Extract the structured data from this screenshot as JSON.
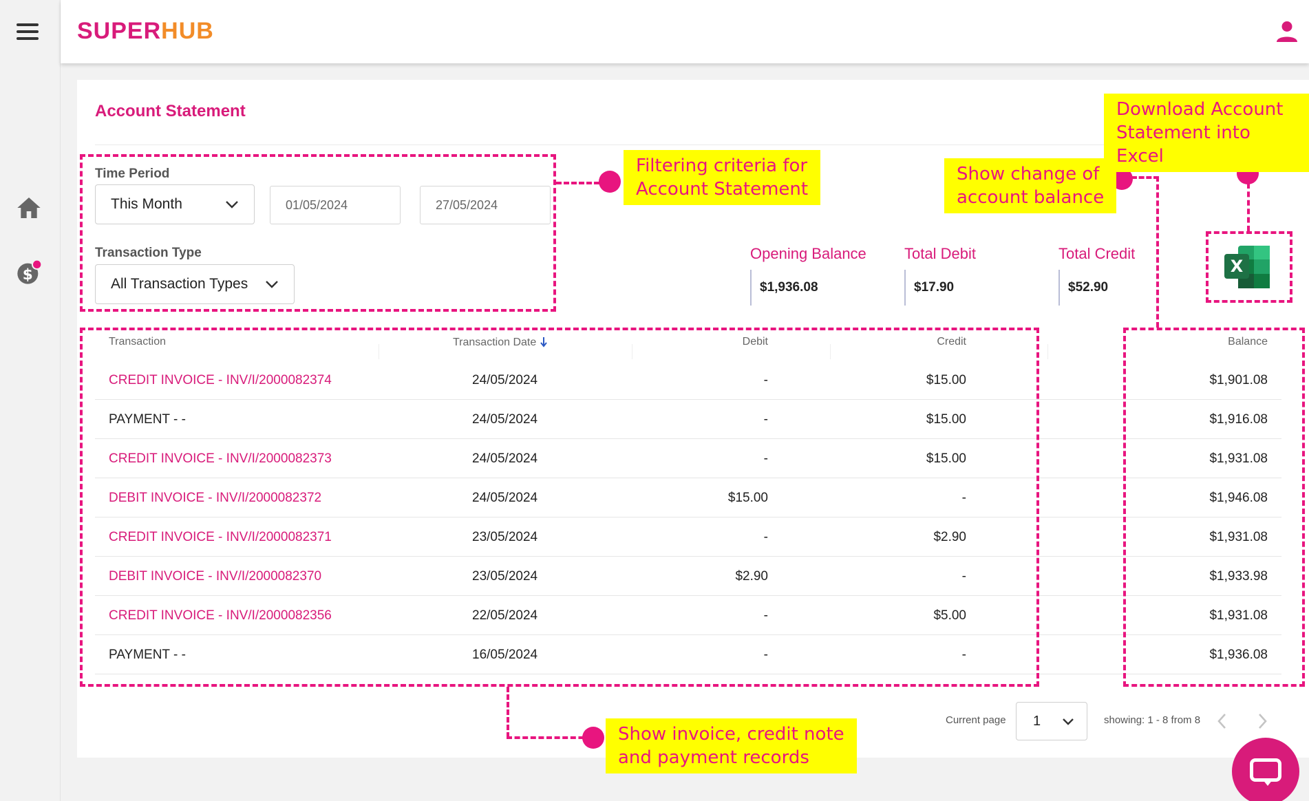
{
  "app": {
    "logo_part1": "SUPER",
    "logo_part2": "HUB"
  },
  "page": {
    "title": "Account Statement"
  },
  "filters": {
    "time_period_label": "Time Period",
    "time_period_value": "This Month",
    "start_date": "01/05/2024",
    "end_date": "27/05/2024",
    "transaction_type_label": "Transaction Type",
    "transaction_type_value": "All Transaction Types"
  },
  "summary": {
    "opening_label": "Opening Balance",
    "opening_value": "$1,936.08",
    "debit_label": "Total Debit",
    "debit_value": "$17.90",
    "credit_label": "Total Credit",
    "credit_value": "$52.90"
  },
  "table": {
    "headers": {
      "transaction": "Transaction",
      "date": "Transaction Date",
      "debit": "Debit",
      "credit": "Credit",
      "balance": "Balance"
    },
    "rows": [
      {
        "transaction": "CREDIT INVOICE - INV/I/2000082374",
        "date": "24/05/2024",
        "debit": "-",
        "credit": "$15.00",
        "balance": "$1,901.08"
      },
      {
        "transaction": "PAYMENT - -",
        "date": "24/05/2024",
        "debit": "-",
        "credit": "$15.00",
        "balance": "$1,916.08"
      },
      {
        "transaction": "CREDIT INVOICE - INV/I/2000082373",
        "date": "24/05/2024",
        "debit": "-",
        "credit": "$15.00",
        "balance": "$1,931.08"
      },
      {
        "transaction": "DEBIT INVOICE - INV/I/2000082372",
        "date": "24/05/2024",
        "debit": "$15.00",
        "credit": "-",
        "balance": "$1,946.08"
      },
      {
        "transaction": "CREDIT INVOICE - INV/I/2000082371",
        "date": "23/05/2024",
        "debit": "-",
        "credit": "$2.90",
        "balance": "$1,931.08"
      },
      {
        "transaction": "DEBIT INVOICE - INV/I/2000082370",
        "date": "23/05/2024",
        "debit": "$2.90",
        "credit": "-",
        "balance": "$1,933.98"
      },
      {
        "transaction": "CREDIT INVOICE - INV/I/2000082356",
        "date": "22/05/2024",
        "debit": "-",
        "credit": "$5.00",
        "balance": "$1,931.08"
      },
      {
        "transaction": "PAYMENT - -",
        "date": "16/05/2024",
        "debit": "-",
        "credit": "-",
        "balance": "$1,936.08"
      }
    ]
  },
  "pagination": {
    "current_label": "Current page",
    "current_value": "1",
    "showing": "showing: 1 - 8 from 8"
  },
  "annotations": {
    "filter_note": "Filtering criteria for\nAccount Statement",
    "balance_note": "Show change of\naccount balance",
    "excel_note": "Download Account\nStatement into Excel",
    "records_note": "Show invoice, credit note\nand payment records"
  },
  "colors": {
    "brand_pink": "#d81b7a",
    "brand_orange": "#f28c28",
    "annotation_magenta": "#e8157f",
    "annotation_yellow": "#ffff00",
    "excel_green": "#1e7145"
  }
}
